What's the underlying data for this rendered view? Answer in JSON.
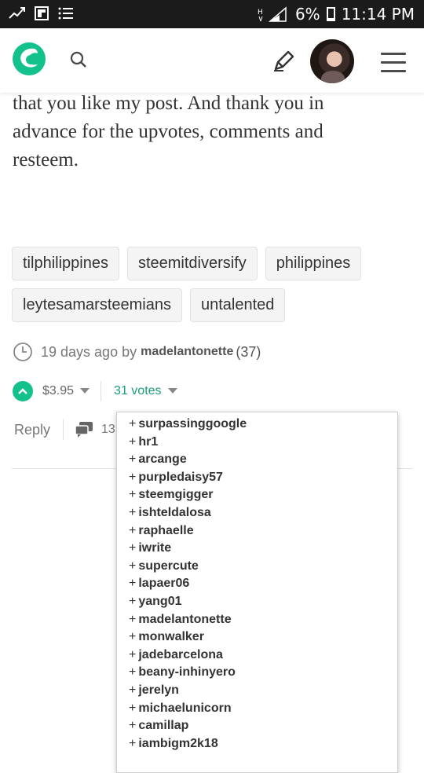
{
  "status_bar": {
    "battery": "6%",
    "time": "11:14 PM",
    "icons": [
      "usb-icon",
      "flipboard-icon",
      "list-icon",
      "signal-icon",
      "battery-icon"
    ]
  },
  "app_bar": {
    "logo": "steemit-logo",
    "icons": [
      "search-icon",
      "edit-icon",
      "avatar",
      "hamburger-menu-icon"
    ]
  },
  "post": {
    "body_lines": [
      "that you like my post. And thank you in",
      "advance for the upvotes, comments and",
      "resteem."
    ],
    "tags": [
      "tilphilippines",
      "steemitdiversify",
      "philippines",
      "leytesamarsteemians",
      "untalented"
    ],
    "time_ago": "19 days ago by",
    "author": "madelantonette",
    "reputation": "(37)",
    "payout": "$3.95",
    "votes_label": "31 votes",
    "reply_label": "Reply",
    "comment_count": "13"
  },
  "voters": [
    "surpassinggoogle",
    "hr1",
    "arcange",
    "purpledaisy57",
    "steemgigger",
    "ishteldalosa",
    "raphaelle",
    "iwrite",
    "supercute",
    "lapaer06",
    "yang01",
    "madelantonette",
    "monwalker",
    "jadebarcelona",
    "beany-inhinyero",
    "jerelyn",
    "michaelunicorn",
    "camillap",
    "iambigm2k18"
  ],
  "colors": {
    "accent": "#13c18d",
    "votes_text": "#1a9d7a",
    "status_bar": "#1b1b1b"
  }
}
